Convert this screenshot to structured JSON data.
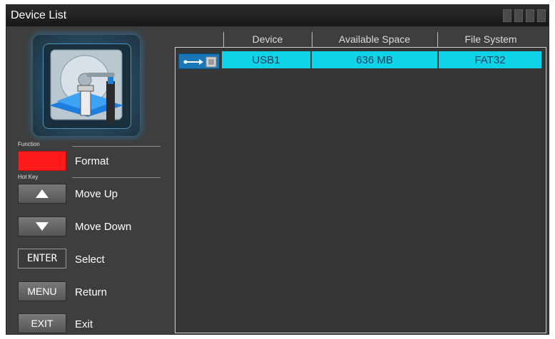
{
  "window": {
    "title": "Device List"
  },
  "function_label": "Function",
  "hotkey_label": "Hot Key",
  "function_key": {
    "color": "#ff1b1b",
    "label": "Format"
  },
  "hotkeys": [
    {
      "key_icon": "triangle-up-icon",
      "label": "Move Up"
    },
    {
      "key_icon": "triangle-down-icon",
      "label": "Move Down"
    },
    {
      "key_text": "ENTER",
      "label": "Select"
    },
    {
      "key_text": "MENU",
      "label": "Return"
    },
    {
      "key_text": "EXIT",
      "label": "Exit"
    }
  ],
  "table": {
    "columns": [
      "Device",
      "Available Space",
      "File System"
    ],
    "rows": [
      {
        "icon": "usb-drive-icon",
        "device": "USB1",
        "space": "636 MB",
        "fs": "FAT32"
      }
    ]
  },
  "colors": {
    "selected_row": "#0fd4e8",
    "panel_bg": "#3e3e3e",
    "title_bg": "#1c1c1c"
  }
}
